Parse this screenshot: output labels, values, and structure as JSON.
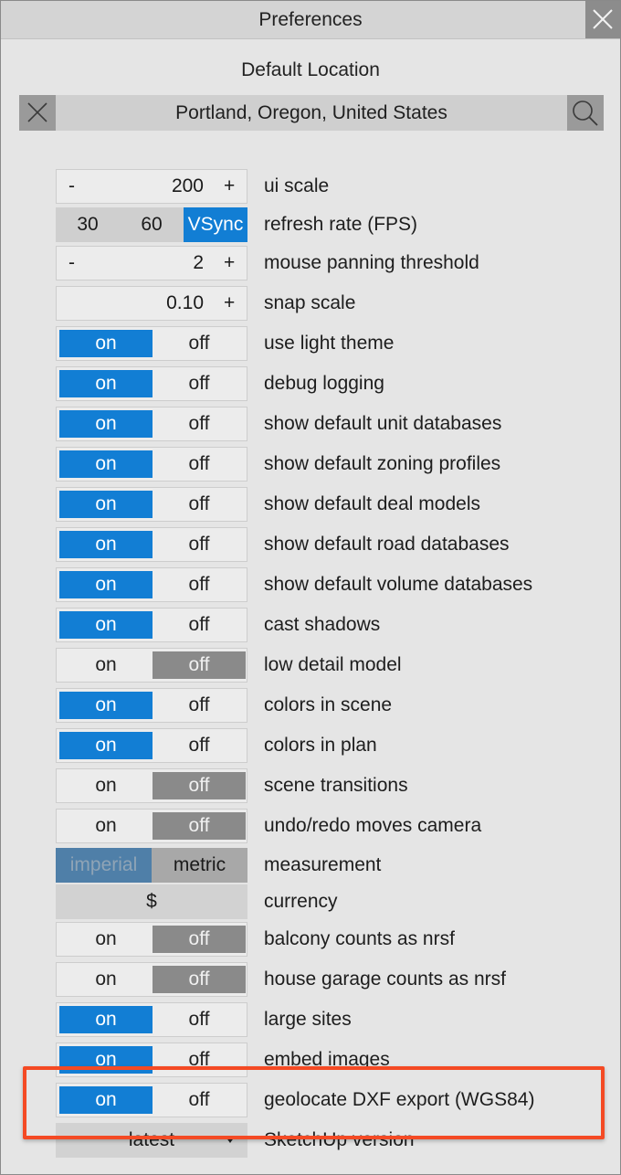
{
  "window": {
    "title": "Preferences"
  },
  "location": {
    "heading": "Default Location",
    "value": "Portland, Oregon, United States"
  },
  "settings": {
    "ui_scale": {
      "minus": "-",
      "value": "200",
      "plus": "+",
      "label": "ui scale"
    },
    "refresh_rate": {
      "options": [
        "30",
        "60",
        "VSync"
      ],
      "selected": "VSync",
      "label": "refresh rate (FPS)"
    },
    "mouse_panning": {
      "minus": "-",
      "value": "2",
      "plus": "+",
      "label": "mouse panning threshold"
    },
    "snap_scale": {
      "value": "0.10",
      "plus": "+",
      "label": "snap scale"
    },
    "toggles": [
      {
        "label": "use light theme",
        "state": "on"
      },
      {
        "label": "debug logging",
        "state": "on"
      },
      {
        "label": "show default unit databases",
        "state": "on"
      },
      {
        "label": "show default zoning profiles",
        "state": "on"
      },
      {
        "label": "show default deal models",
        "state": "on"
      },
      {
        "label": "show default road databases",
        "state": "on"
      },
      {
        "label": "show default volume databases",
        "state": "on"
      },
      {
        "label": "cast shadows",
        "state": "on"
      },
      {
        "label": "low detail model",
        "state": "off"
      },
      {
        "label": "colors in scene",
        "state": "on"
      },
      {
        "label": "colors in plan",
        "state": "on"
      },
      {
        "label": "scene transitions",
        "state": "off"
      },
      {
        "label": "undo/redo moves camera",
        "state": "off"
      }
    ],
    "on_text": "on",
    "off_text": "off",
    "measurement": {
      "option_a": "imperial",
      "option_b": "metric",
      "selected": "imperial",
      "label": "measurement"
    },
    "currency": {
      "value": "$",
      "label": "currency"
    },
    "toggles_2": [
      {
        "label": "balcony counts as nrsf",
        "state": "off"
      },
      {
        "label": "house garage counts as nrsf",
        "state": "off"
      },
      {
        "label": "large sites",
        "state": "on"
      },
      {
        "label": "embed images",
        "state": "on"
      },
      {
        "label": "geolocate DXF export (WGS84)",
        "state": "on"
      }
    ],
    "sketchup_version": {
      "value": "latest",
      "label": "SketchUp version"
    }
  },
  "colors": {
    "accent": "#127ed4",
    "off_active": "#8a8a8a",
    "highlight": "#f44a24"
  }
}
